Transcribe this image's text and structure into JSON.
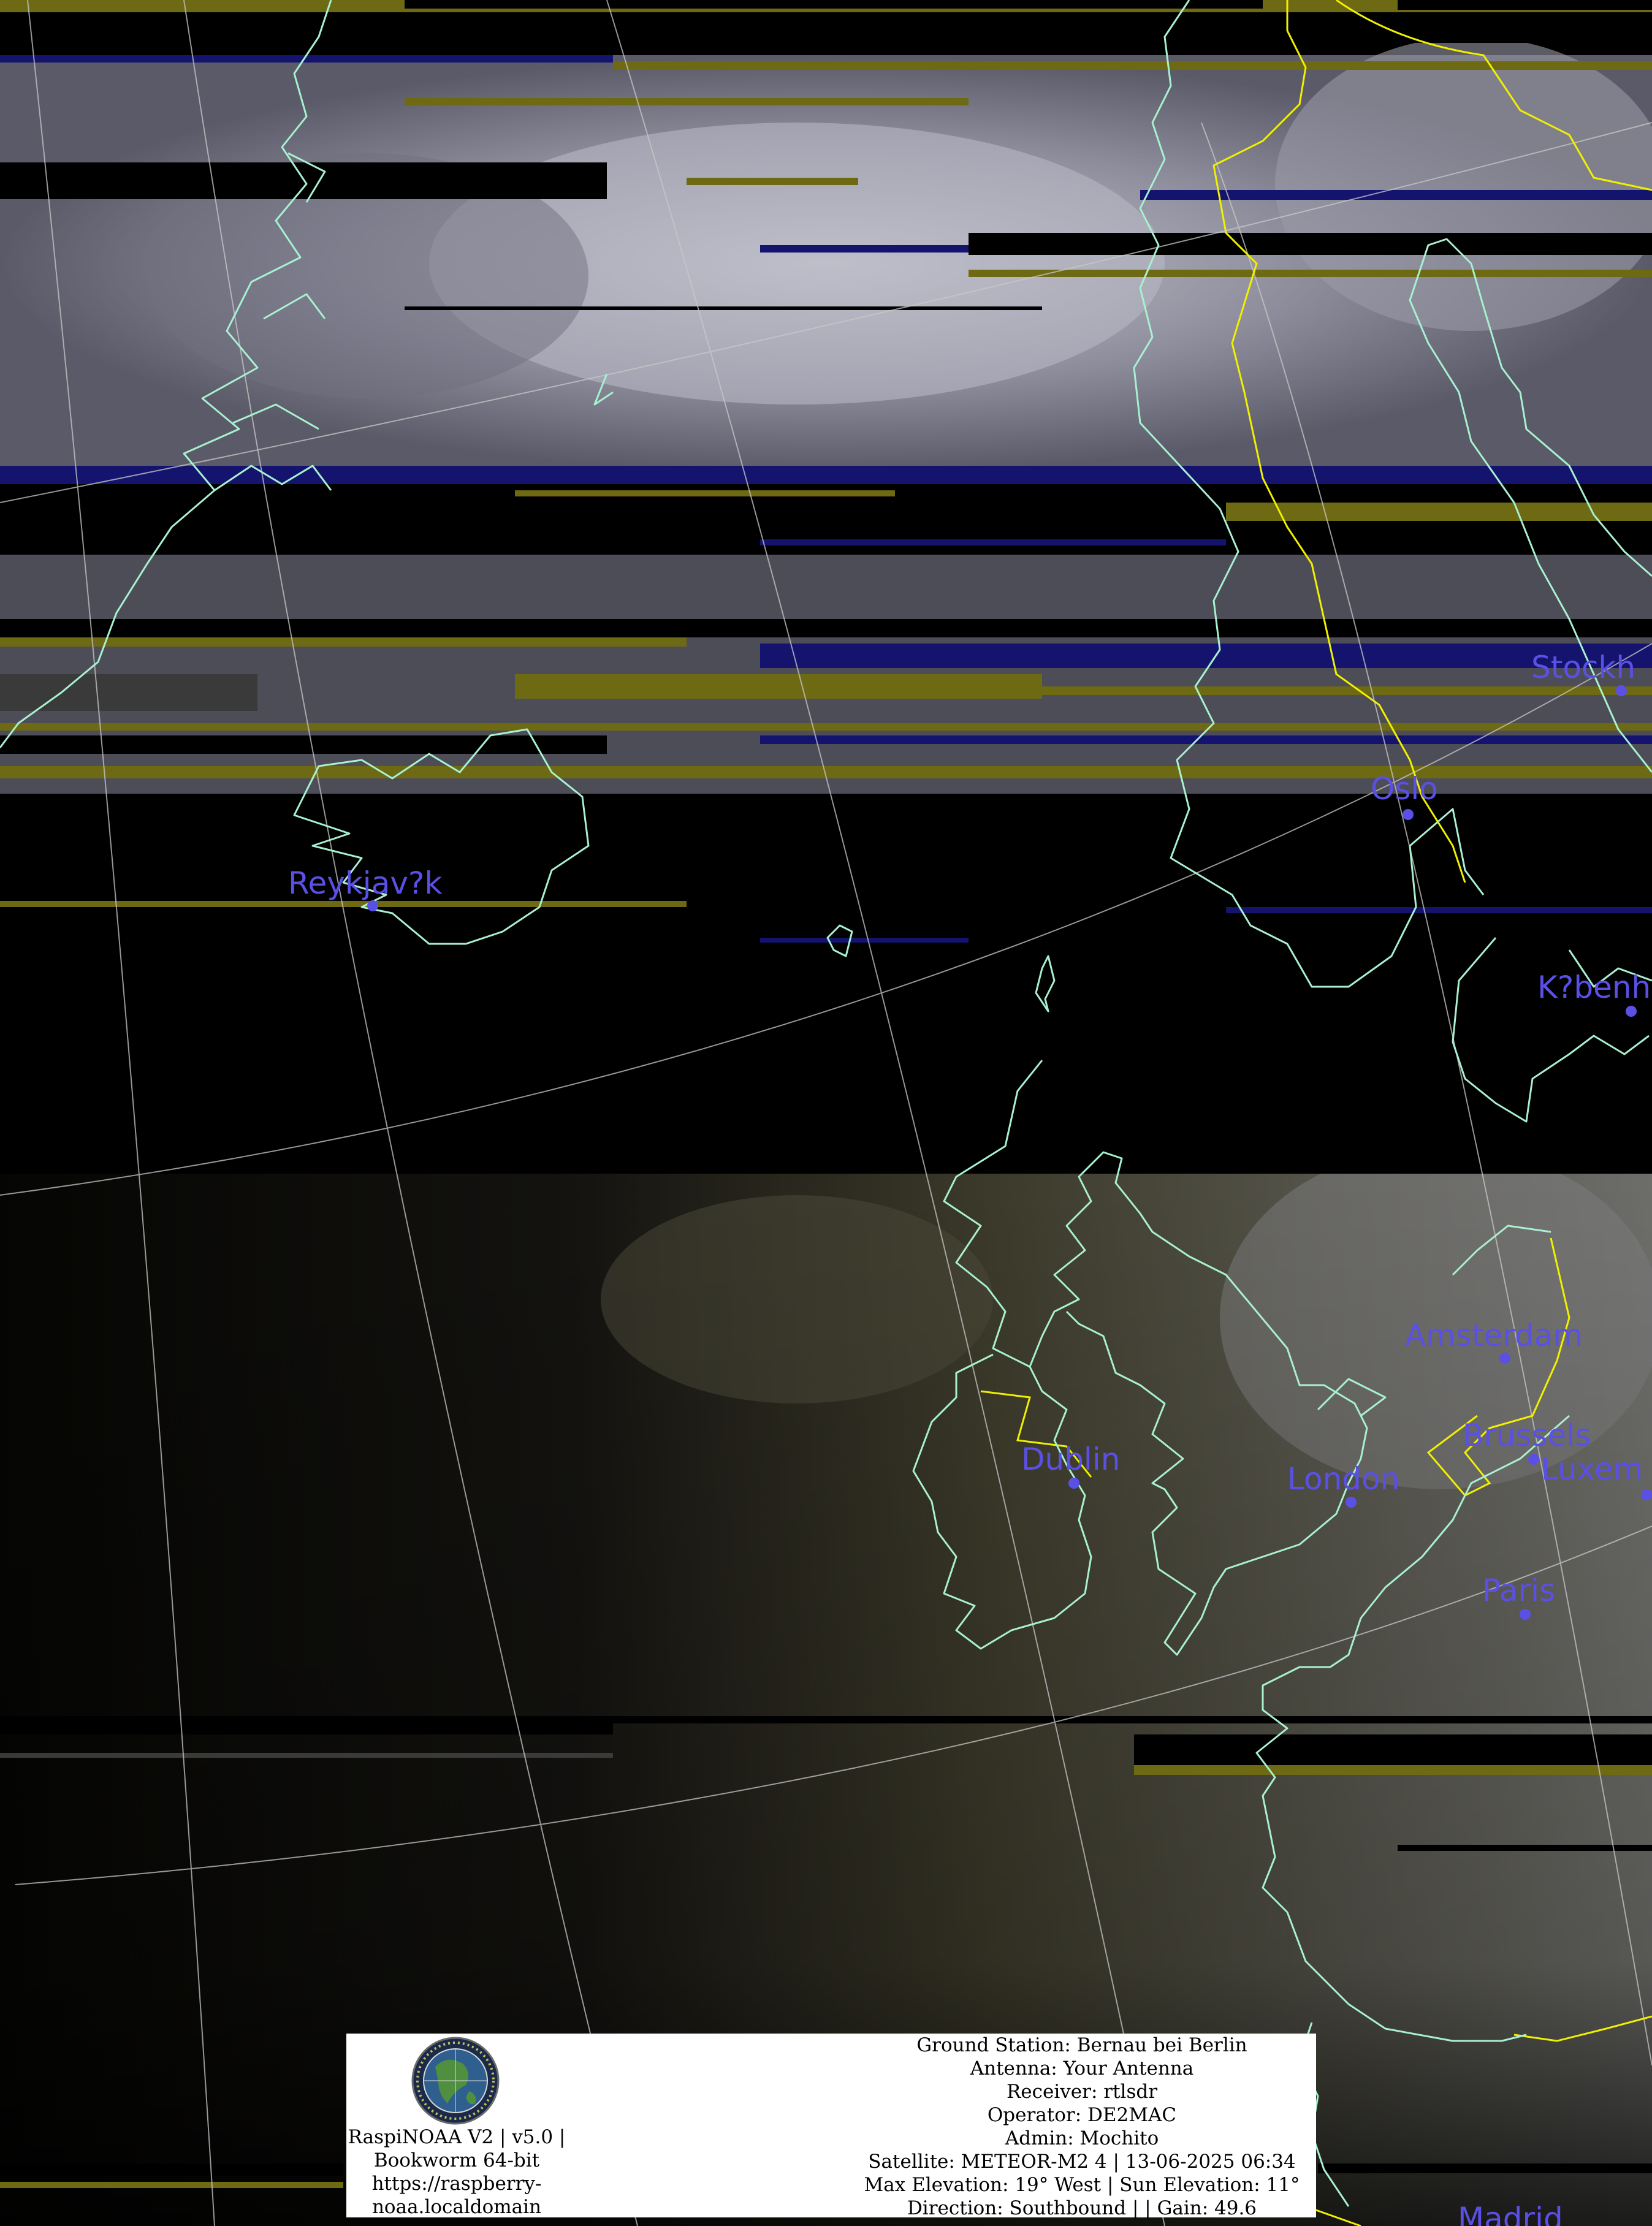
{
  "map": {
    "cities": [
      {
        "name": "Reykjav?k"
      },
      {
        "name": "Oslo"
      },
      {
        "name": "Stockh"
      },
      {
        "name": "K?benh"
      },
      {
        "name": "Amsterdam"
      },
      {
        "name": "Brussels"
      },
      {
        "name": "Luxem"
      },
      {
        "name": "Dublin"
      },
      {
        "name": "London"
      },
      {
        "name": "Paris"
      },
      {
        "name": "Madrid"
      }
    ],
    "colors": {
      "coastline": "#a8f0d0",
      "border": "#f0f000",
      "graticule": "#c8c8c8",
      "city": "#5b50e6",
      "artifact_yellow": "#6e6a14",
      "artifact_blue": "#14146e"
    }
  },
  "info_box": {
    "logo_icon": "raspinoaa-globe-logo",
    "station": {
      "line1": "RaspiNOAA V2 | v5.0 |",
      "line2": "Bookworm 64-bit",
      "line3": "https://raspberry-",
      "line4": "noaa.localdomain"
    },
    "details": {
      "ground_station": "Ground Station: Bernau bei Berlin",
      "antenna": "Antenna: Your Antenna",
      "receiver": "Receiver: rtlsdr",
      "operator": "Operator: DE2MAC",
      "admin": "Admin: Mochito",
      "satellite": "Satellite: METEOR-M2 4 | 13-06-2025 06:34",
      "elevation": "Max Elevation: 19° West | Sun Elevation: 11°",
      "direction": "Direction: Southbound | | Gain: 49.6"
    }
  }
}
